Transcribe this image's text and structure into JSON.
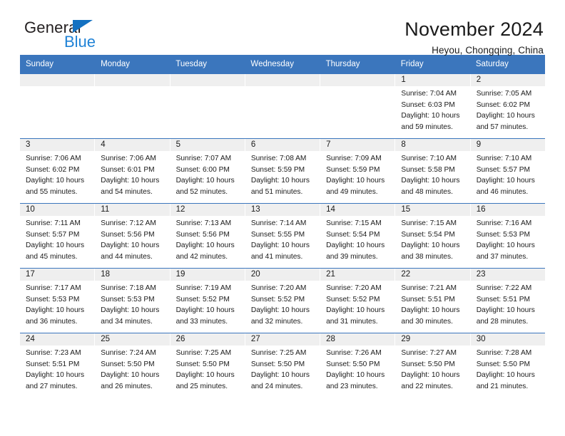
{
  "logo": {
    "primary_text": "General",
    "secondary_text": "Blue",
    "triangle_icon": "triangle-icon",
    "primary_color": "#231f20",
    "secondary_color": "#1f82d6"
  },
  "header": {
    "title": "November 2024",
    "subtitle": "Heyou, Chongqing, China"
  },
  "theme": {
    "header_blue": "#3b76bd",
    "daynum_band": "#efefef",
    "text": "#1a1a1a"
  },
  "weekday_headers": [
    "Sunday",
    "Monday",
    "Tuesday",
    "Wednesday",
    "Thursday",
    "Friday",
    "Saturday"
  ],
  "labels": {
    "sunrise_prefix": "Sunrise:",
    "sunset_prefix": "Sunset:",
    "daylight_prefix": "Daylight:"
  },
  "weeks": [
    [
      {
        "day": "",
        "empty": true
      },
      {
        "day": "",
        "empty": true
      },
      {
        "day": "",
        "empty": true
      },
      {
        "day": "",
        "empty": true
      },
      {
        "day": "",
        "empty": true
      },
      {
        "day": "1",
        "sunrise": "Sunrise: 7:04 AM",
        "sunset": "Sunset: 6:03 PM",
        "daylight": "Daylight: 10 hours and 59 minutes."
      },
      {
        "day": "2",
        "sunrise": "Sunrise: 7:05 AM",
        "sunset": "Sunset: 6:02 PM",
        "daylight": "Daylight: 10 hours and 57 minutes."
      }
    ],
    [
      {
        "day": "3",
        "sunrise": "Sunrise: 7:06 AM",
        "sunset": "Sunset: 6:02 PM",
        "daylight": "Daylight: 10 hours and 55 minutes."
      },
      {
        "day": "4",
        "sunrise": "Sunrise: 7:06 AM",
        "sunset": "Sunset: 6:01 PM",
        "daylight": "Daylight: 10 hours and 54 minutes."
      },
      {
        "day": "5",
        "sunrise": "Sunrise: 7:07 AM",
        "sunset": "Sunset: 6:00 PM",
        "daylight": "Daylight: 10 hours and 52 minutes."
      },
      {
        "day": "6",
        "sunrise": "Sunrise: 7:08 AM",
        "sunset": "Sunset: 5:59 PM",
        "daylight": "Daylight: 10 hours and 51 minutes."
      },
      {
        "day": "7",
        "sunrise": "Sunrise: 7:09 AM",
        "sunset": "Sunset: 5:59 PM",
        "daylight": "Daylight: 10 hours and 49 minutes."
      },
      {
        "day": "8",
        "sunrise": "Sunrise: 7:10 AM",
        "sunset": "Sunset: 5:58 PM",
        "daylight": "Daylight: 10 hours and 48 minutes."
      },
      {
        "day": "9",
        "sunrise": "Sunrise: 7:10 AM",
        "sunset": "Sunset: 5:57 PM",
        "daylight": "Daylight: 10 hours and 46 minutes."
      }
    ],
    [
      {
        "day": "10",
        "sunrise": "Sunrise: 7:11 AM",
        "sunset": "Sunset: 5:57 PM",
        "daylight": "Daylight: 10 hours and 45 minutes."
      },
      {
        "day": "11",
        "sunrise": "Sunrise: 7:12 AM",
        "sunset": "Sunset: 5:56 PM",
        "daylight": "Daylight: 10 hours and 44 minutes."
      },
      {
        "day": "12",
        "sunrise": "Sunrise: 7:13 AM",
        "sunset": "Sunset: 5:56 PM",
        "daylight": "Daylight: 10 hours and 42 minutes."
      },
      {
        "day": "13",
        "sunrise": "Sunrise: 7:14 AM",
        "sunset": "Sunset: 5:55 PM",
        "daylight": "Daylight: 10 hours and 41 minutes."
      },
      {
        "day": "14",
        "sunrise": "Sunrise: 7:15 AM",
        "sunset": "Sunset: 5:54 PM",
        "daylight": "Daylight: 10 hours and 39 minutes."
      },
      {
        "day": "15",
        "sunrise": "Sunrise: 7:15 AM",
        "sunset": "Sunset: 5:54 PM",
        "daylight": "Daylight: 10 hours and 38 minutes."
      },
      {
        "day": "16",
        "sunrise": "Sunrise: 7:16 AM",
        "sunset": "Sunset: 5:53 PM",
        "daylight": "Daylight: 10 hours and 37 minutes."
      }
    ],
    [
      {
        "day": "17",
        "sunrise": "Sunrise: 7:17 AM",
        "sunset": "Sunset: 5:53 PM",
        "daylight": "Daylight: 10 hours and 36 minutes."
      },
      {
        "day": "18",
        "sunrise": "Sunrise: 7:18 AM",
        "sunset": "Sunset: 5:53 PM",
        "daylight": "Daylight: 10 hours and 34 minutes."
      },
      {
        "day": "19",
        "sunrise": "Sunrise: 7:19 AM",
        "sunset": "Sunset: 5:52 PM",
        "daylight": "Daylight: 10 hours and 33 minutes."
      },
      {
        "day": "20",
        "sunrise": "Sunrise: 7:20 AM",
        "sunset": "Sunset: 5:52 PM",
        "daylight": "Daylight: 10 hours and 32 minutes."
      },
      {
        "day": "21",
        "sunrise": "Sunrise: 7:20 AM",
        "sunset": "Sunset: 5:52 PM",
        "daylight": "Daylight: 10 hours and 31 minutes."
      },
      {
        "day": "22",
        "sunrise": "Sunrise: 7:21 AM",
        "sunset": "Sunset: 5:51 PM",
        "daylight": "Daylight: 10 hours and 30 minutes."
      },
      {
        "day": "23",
        "sunrise": "Sunrise: 7:22 AM",
        "sunset": "Sunset: 5:51 PM",
        "daylight": "Daylight: 10 hours and 28 minutes."
      }
    ],
    [
      {
        "day": "24",
        "sunrise": "Sunrise: 7:23 AM",
        "sunset": "Sunset: 5:51 PM",
        "daylight": "Daylight: 10 hours and 27 minutes."
      },
      {
        "day": "25",
        "sunrise": "Sunrise: 7:24 AM",
        "sunset": "Sunset: 5:50 PM",
        "daylight": "Daylight: 10 hours and 26 minutes."
      },
      {
        "day": "26",
        "sunrise": "Sunrise: 7:25 AM",
        "sunset": "Sunset: 5:50 PM",
        "daylight": "Daylight: 10 hours and 25 minutes."
      },
      {
        "day": "27",
        "sunrise": "Sunrise: 7:25 AM",
        "sunset": "Sunset: 5:50 PM",
        "daylight": "Daylight: 10 hours and 24 minutes."
      },
      {
        "day": "28",
        "sunrise": "Sunrise: 7:26 AM",
        "sunset": "Sunset: 5:50 PM",
        "daylight": "Daylight: 10 hours and 23 minutes."
      },
      {
        "day": "29",
        "sunrise": "Sunrise: 7:27 AM",
        "sunset": "Sunset: 5:50 PM",
        "daylight": "Daylight: 10 hours and 22 minutes."
      },
      {
        "day": "30",
        "sunrise": "Sunrise: 7:28 AM",
        "sunset": "Sunset: 5:50 PM",
        "daylight": "Daylight: 10 hours and 21 minutes."
      }
    ]
  ]
}
